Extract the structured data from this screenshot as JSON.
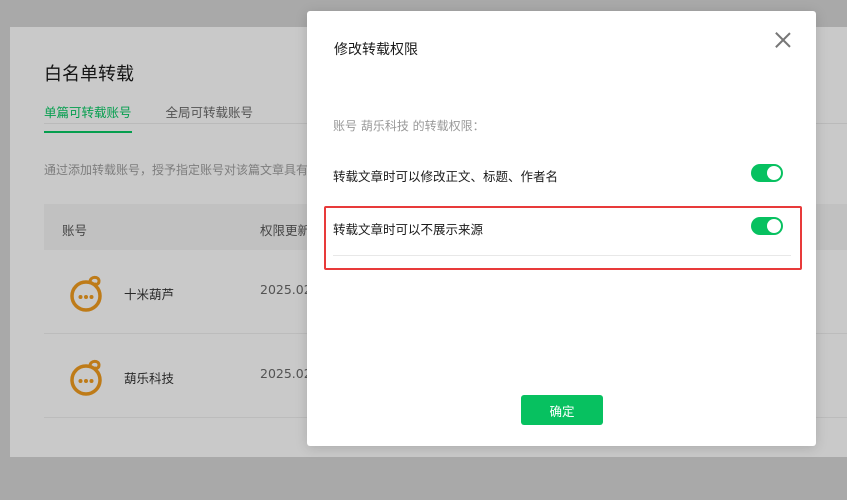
{
  "page": {
    "title": "白名单转载",
    "tabs": [
      {
        "label": "单篇可转载账号",
        "active": true
      },
      {
        "label": "全局可转载账号",
        "active": false
      }
    ],
    "description": "通过添加转载账号，授予指定账号对该篇文章具有",
    "table": {
      "headers": {
        "account": "账号",
        "time": "权限更新"
      },
      "rows": [
        {
          "name": "十米葫芦",
          "date": "2025.02."
        },
        {
          "name": "葫乐科技",
          "date": "2025.02."
        }
      ]
    }
  },
  "dialog": {
    "title": "修改转载权限",
    "permission_label": "账号 葫乐科技 的转载权限：",
    "settings": [
      {
        "label": "转载文章时可以修改正文、标题、作者名",
        "enabled": true
      },
      {
        "label": "转载文章时可以不展示来源",
        "enabled": true
      }
    ],
    "confirm_label": "确定"
  },
  "colors": {
    "accent": "#07c160",
    "highlight": "#e83a3a",
    "avatar": "#e8961e"
  }
}
